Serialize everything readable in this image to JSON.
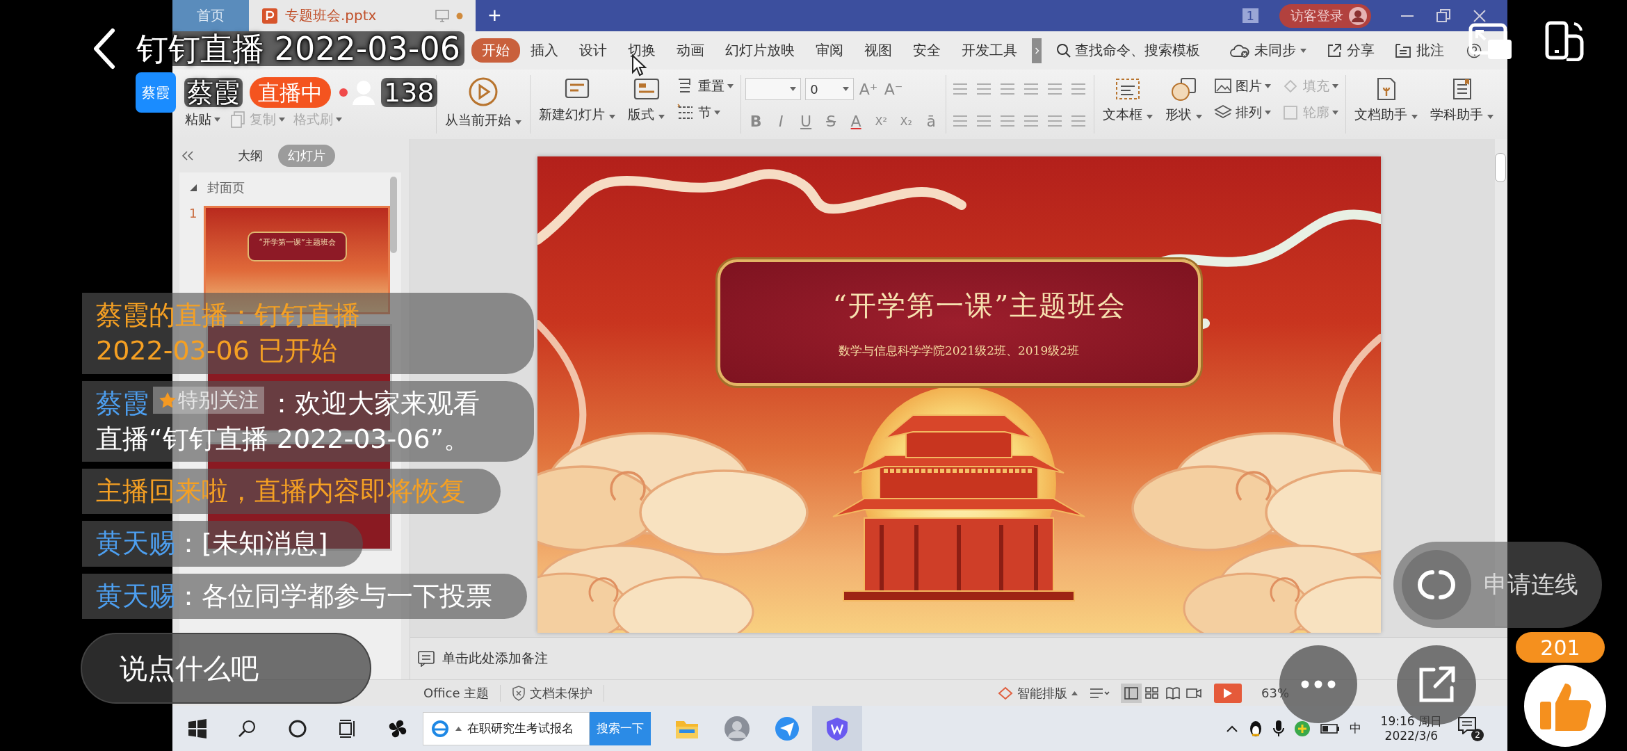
{
  "live": {
    "title": "钉钉直播 2022-03-06",
    "avatar_text": "蔡霞",
    "host": "蔡霞",
    "status": "直播中",
    "viewers": "138"
  },
  "chat": [
    {
      "kind": "notice",
      "text": "蔡霞的直播：钉钉直播 2022-03-06 已开始"
    },
    {
      "kind": "message",
      "sender": "蔡霞",
      "tag": "特别关注",
      "text": "：欢迎大家来观看直播“钉钉直播 2022-03-06”。"
    },
    {
      "kind": "notice",
      "text": "主播回来啦，直播内容即将恢复"
    },
    {
      "kind": "message",
      "sender": "黄天赐",
      "text": "：[未知消息]"
    },
    {
      "kind": "message",
      "sender": "黄天赐",
      "text": "：各位同学都参与一下投票"
    }
  ],
  "connect_button": "申请连线",
  "comment_field": {
    "placeholder": "说点什么吧"
  },
  "likes": "201",
  "wps": {
    "doc_tabs": [
      {
        "label": "首页",
        "selected": false
      },
      {
        "label": "专题班会.pptx",
        "selected": true
      }
    ],
    "new_tab": "+",
    "window_count": "1",
    "login_button": "访客登录",
    "menu_tabs": [
      {
        "label": "开始",
        "selected": true
      },
      {
        "label": "插入",
        "selected": false
      },
      {
        "label": "设计",
        "selected": false
      },
      {
        "label": "切换",
        "selected": false
      },
      {
        "label": "动画",
        "selected": false
      },
      {
        "label": "幻灯片放映",
        "selected": false
      },
      {
        "label": "审阅",
        "selected": false
      },
      {
        "label": "视图",
        "selected": false
      },
      {
        "label": "安全",
        "selected": false
      },
      {
        "label": "开发工具",
        "selected": false
      }
    ],
    "search": "查找命令、搜索模板",
    "menu_actions": [
      "未同步",
      "分享",
      "批注"
    ],
    "ribbon": [
      {
        "label": "粘贴",
        "disabled": false
      },
      {
        "label": "复制",
        "disabled": true
      },
      {
        "label": "格式刷",
        "disabled": true
      },
      {
        "label": "从当前开始",
        "disabled": false
      },
      {
        "label": "新建幻灯片",
        "disabled": false
      },
      {
        "label": "版式",
        "disabled": false
      },
      {
        "label": "重置",
        "disabled": false
      },
      {
        "label": "节",
        "disabled": false
      },
      {
        "label": "文本框",
        "disabled": false
      },
      {
        "label": "形状",
        "disabled": false
      },
      {
        "label": "图片",
        "disabled": false
      },
      {
        "label": "排列",
        "disabled": false
      },
      {
        "label": "填充",
        "disabled": true
      },
      {
        "label": "轮廓",
        "disabled": true
      },
      {
        "label": "文档助手",
        "disabled": false
      },
      {
        "label": "学科助手",
        "disabled": false
      }
    ],
    "font_size": "0",
    "font_buttons": [
      "A⁺",
      "A⁻"
    ],
    "format_buttons": [
      "B",
      "I",
      "U",
      "S",
      "A",
      "X²",
      "X₂",
      "ā"
    ],
    "pane": {
      "tabs": [
        {
          "label": "大纲",
          "selected": false
        },
        {
          "label": "幻灯片",
          "selected": true
        }
      ],
      "section": "封面页",
      "slides": [
        {
          "number": "1",
          "title": "“开学第一课”主题班会",
          "selected": true
        },
        {
          "selected": false
        },
        {
          "selected": false
        }
      ]
    },
    "slide": {
      "title": "“开学第一课”主题班会",
      "subtitle": "数学与信息科学学院2021级2班、2019级2班"
    },
    "notes_hint": "单击此处添加备注",
    "status": {
      "theme": "Office 主题",
      "protection": "文档未保护",
      "smart_layout": "智能排版",
      "view_buttons": [
        {
          "selected": true
        },
        {
          "selected": false
        },
        {
          "selected": false
        },
        {
          "selected": false
        }
      ],
      "zoom": "63%"
    }
  },
  "taskbar": {
    "search": "在职研究生考试报名",
    "search_button": "搜索一下",
    "apps": [
      {
        "active": false
      },
      {
        "active": false
      },
      {
        "active": false
      },
      {
        "active": false
      },
      {
        "active": true
      }
    ],
    "ime": "中",
    "time": "19:16 周日",
    "date": "2022/3/6",
    "notifications": "2"
  }
}
